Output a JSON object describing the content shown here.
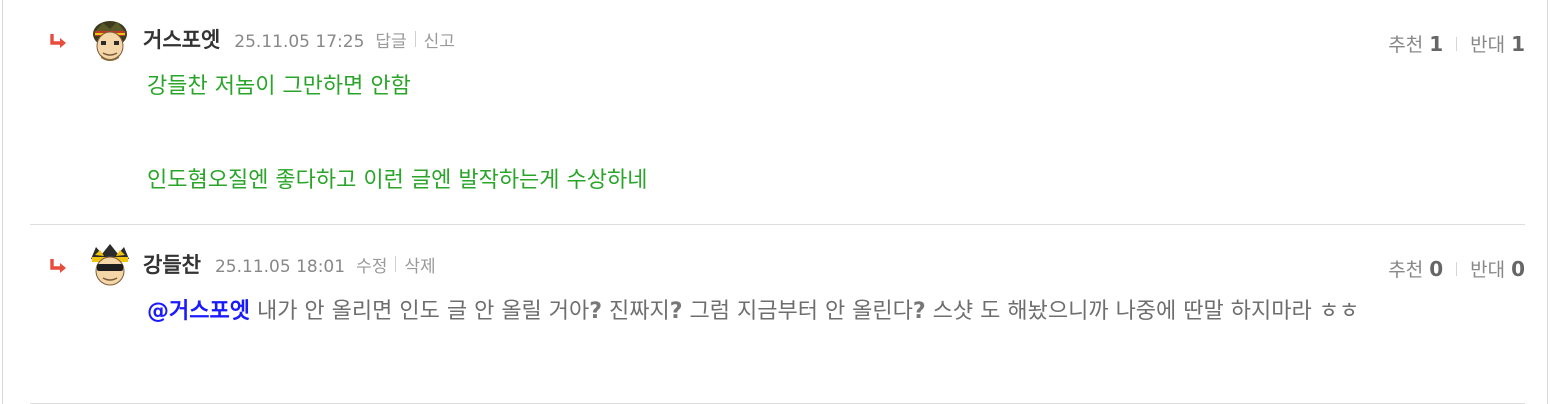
{
  "comments": [
    {
      "nickname": "거스포엣",
      "date": "25.11.05 17:25",
      "actions": [
        "답글",
        "신고"
      ],
      "votes": {
        "up_label": "추천",
        "up_count": "1",
        "down_label": "반대",
        "down_count": "1"
      },
      "lines": [
        "강들찬 저놈이 그만하면 안함",
        "인도혐오질엔 좋다하고 이런 글엔 발작하는게 수상하네"
      ],
      "text_color": "#2aa52a"
    },
    {
      "nickname": "강들찬",
      "date": "25.11.05 18:01",
      "actions": [
        "수정",
        "삭제"
      ],
      "votes": {
        "up_label": "추천",
        "up_count": "0",
        "down_label": "반대",
        "down_count": "0"
      },
      "mention": "@거스포엣",
      "seg1": " 내가 안 올리면 인도 글 안 올릴 거아",
      "seg2": "?",
      "seg3": " 진짜지",
      "seg4": "?",
      "seg5": " 그럼 지금부터 안 올린다",
      "seg6": "?",
      "seg7": " 스샷 도 해놨으니까 나중에 딴말 하지마라 ㅎㅎ"
    }
  ],
  "icons": {
    "reply": "reply-arrow-icon",
    "avatar": "user-avatar-icon"
  },
  "colors": {
    "reply_arrow": "#e84c3d",
    "mention": "#1a1aff"
  }
}
